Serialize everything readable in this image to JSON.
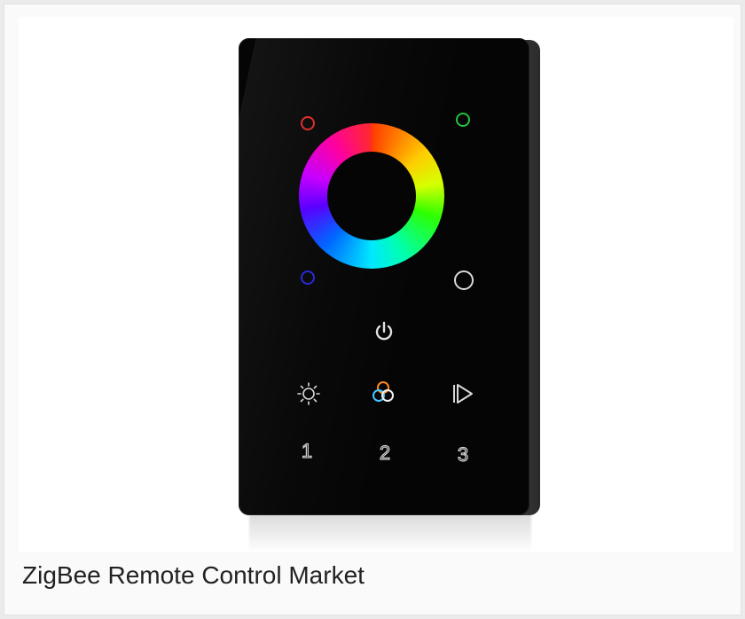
{
  "caption": "ZigBee Remote Control Market",
  "photo": {
    "subject": "Wall-mounted touch panel remote with RGB color wheel",
    "colors": {
      "red_dot": "#e0302c",
      "green_dot": "#22c43a",
      "blue_dot": "#2a2ad8",
      "white_dot": "#d8d8d8",
      "panel": "#050505"
    },
    "buttons": {
      "power_icon": "power-icon",
      "brightness_icon": "brightness-icon",
      "color_mix_icon": "color-mix-icon",
      "play_icon": "play-icon"
    },
    "scene_labels": [
      "1",
      "2",
      "3"
    ]
  }
}
